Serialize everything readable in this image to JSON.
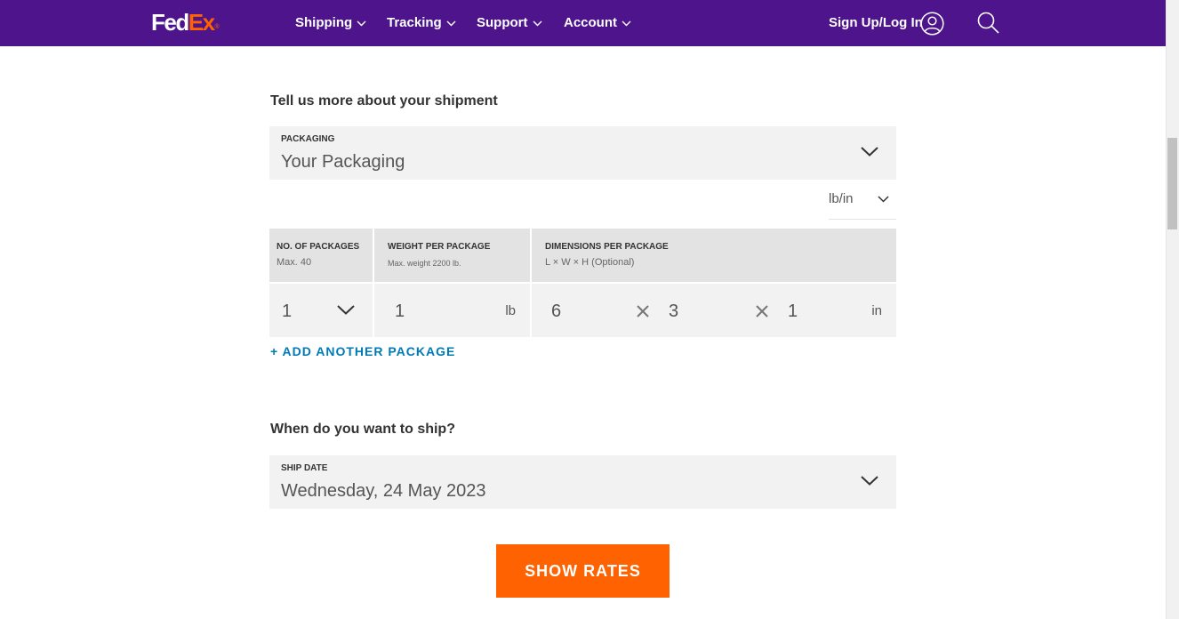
{
  "header": {
    "logo": {
      "fed": "Fed",
      "ex": "Ex",
      "reg": "®"
    },
    "nav": [
      {
        "label": "Shipping"
      },
      {
        "label": "Tracking"
      },
      {
        "label": "Support"
      },
      {
        "label": "Account"
      }
    ],
    "signin_label": "Sign Up/Log In",
    "colors": {
      "brand_purple": "#4d148c",
      "brand_orange": "#ff6200"
    }
  },
  "shipment": {
    "title": "Tell us more about your shipment",
    "packaging": {
      "label": "PACKAGING",
      "value": "Your Packaging"
    },
    "unit_system": "lb/in",
    "table": {
      "headers": [
        {
          "title": "NO. OF PACKAGES",
          "sub": "Max. 40"
        },
        {
          "title": "WEIGHT PER PACKAGE",
          "sub": "Max. weight 2200 lb."
        },
        {
          "title": "DIMENSIONS PER PACKAGE",
          "sub": "L × W × H (Optional)"
        }
      ],
      "packages": "1",
      "weight": "1",
      "weight_unit": "lb",
      "length": "6",
      "width": "3",
      "height": "1",
      "dim_unit": "in"
    },
    "add_package_label": "+ ADD ANOTHER PACKAGE"
  },
  "ship_date": {
    "title": "When do you want to ship?",
    "label": "SHIP DATE",
    "value": "Wednesday, 24 May 2023"
  },
  "show_rates_label": "SHOW RATES"
}
